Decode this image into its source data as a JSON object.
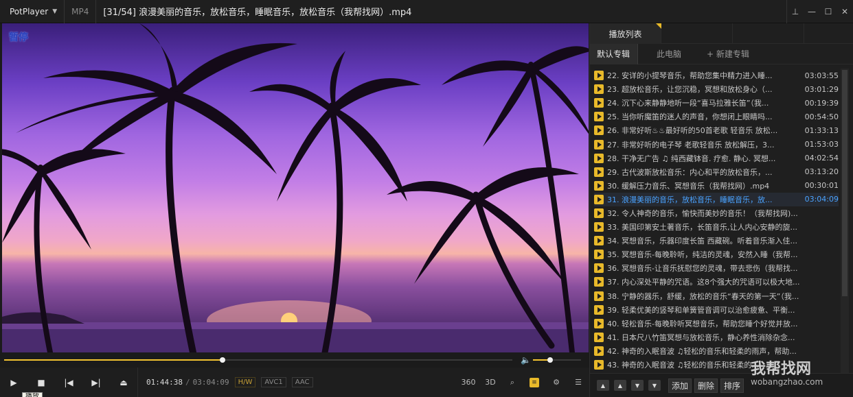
{
  "window": {
    "app_name": "PotPlayer",
    "format": "MP4",
    "title": "[31/54] 浪漫美丽的音乐，放松音乐，睡眠音乐，放松音乐（我帮找网）.mp4"
  },
  "video": {
    "overlay_text": "暂停"
  },
  "playback": {
    "current_time": "01:44:38",
    "duration": "03:04:09",
    "progress_fraction": 0.43,
    "volume_fraction": 0.35,
    "tags": [
      "H/W",
      "AVC1",
      "AAC"
    ],
    "tooltip": "播放"
  },
  "toolbar_icons": [
    "360",
    "3D"
  ],
  "playlist": {
    "tab_label": "播放列表",
    "albums": [
      "默认专辑",
      "此电脑",
      "+ 新建专辑"
    ],
    "items": [
      {
        "n": "22. 安详的小提琴音乐，帮助您集中精力进入睡...",
        "d": "03:03:55"
      },
      {
        "n": "23. 超放松音乐，让您沉稳，冥想和放松身心（...",
        "d": "03:01:29"
      },
      {
        "n": "24. 沉下心来静静地听一段“喜马拉雅长笛”（我...",
        "d": "00:19:39"
      },
      {
        "n": "25. 当你听魔笛的迷人的声音，你想闭上眼睛吗...",
        "d": "00:54:50"
      },
      {
        "n": "26. 非常好听♨♨最好听的50首老歌 轻音乐 放松...",
        "d": "01:33:13"
      },
      {
        "n": "27. 非常好听的电子琴 老歌轻音乐 放松解压，3...",
        "d": "01:53:03"
      },
      {
        "n": "28. 干净无广告 ♫ 纯西藏钵音. 疗愈. 静心. 冥想...",
        "d": "04:02:54"
      },
      {
        "n": "29. 古代波斯放松音乐：内心和平的放松音乐，...",
        "d": "03:13:20"
      },
      {
        "n": "30. 缓解压力音乐、冥想音乐（我帮找网）.mp4",
        "d": "00:30:01"
      },
      {
        "n": "31. 浪漫美丽的音乐，放松音乐，睡眠音乐，放...",
        "d": "03:04:09",
        "current": true
      },
      {
        "n": "32. 令人神奇的音乐，愉快而美妙的音乐！（我帮找网)...",
        "d": ""
      },
      {
        "n": "33. 美国印第安土著音乐，长笛音乐,让人内心安静的旋...",
        "d": ""
      },
      {
        "n": "34. 冥想音乐，乐器印度长笛 西藏碗。听着音乐渐入佳...",
        "d": ""
      },
      {
        "n": "35. 冥想音乐-每晚聆听，纯洁的灵魂，安然入睡（我帮...",
        "d": ""
      },
      {
        "n": "36. 冥想音乐-让音乐抚慰您的灵魂，带去悲伤（我帮找...",
        "d": ""
      },
      {
        "n": "37. 内心深处平静的咒语。这8个强大的咒语可以极大地...",
        "d": ""
      },
      {
        "n": "38. 宁静的器乐，舒缓，放松的音乐“春天的第一天”（我...",
        "d": ""
      },
      {
        "n": "39. 轻柔优美的竖琴和单簧管音调可以治愈疲惫、平衡...",
        "d": ""
      },
      {
        "n": "40. 轻松音乐-每晚聆听冥想音乐，帮助您睡个好觉并放...",
        "d": ""
      },
      {
        "n": "41. 日本尺八竹笛冥想与放松音乐，静心养性消除杂念...",
        "d": ""
      },
      {
        "n": "42. 神奇的入眠音波 ♫轻松的音乐和轻柔的雨声，帮助...",
        "d": ""
      },
      {
        "n": "43. 神奇的入眠音波 ♫轻松的音乐和轻柔的...",
        "d": ""
      }
    ],
    "footer_buttons": [
      "添加",
      "删除",
      "排序"
    ]
  },
  "watermark": {
    "text": "我帮找网",
    "url": "wobangzhao.com"
  }
}
